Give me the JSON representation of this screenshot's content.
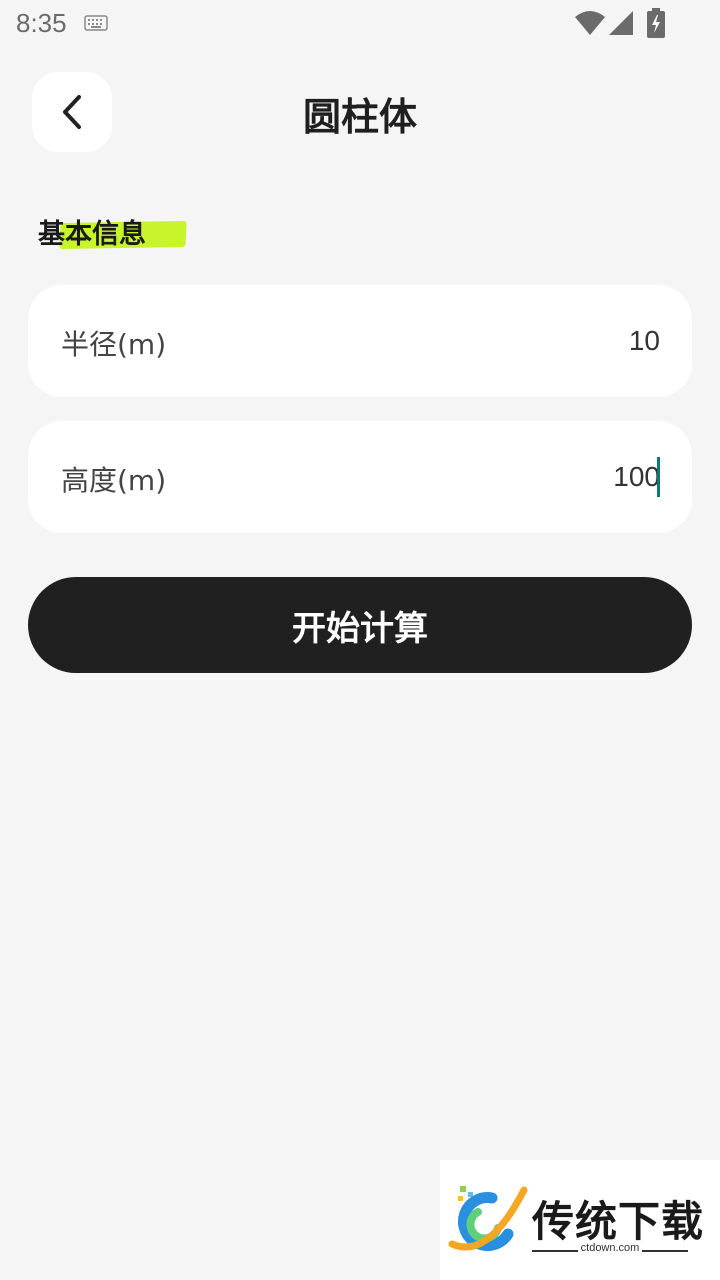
{
  "status_bar": {
    "time": "8:35"
  },
  "header": {
    "title": "圆柱体",
    "back_icon": "chevron-left-icon"
  },
  "section": {
    "title": "基本信息",
    "highlight_color": "#c7f42a"
  },
  "fields": [
    {
      "label": "半径(m)",
      "value": "10"
    },
    {
      "label": "高度(m)",
      "value": "100"
    }
  ],
  "actions": {
    "calculate_label": "开始计算"
  },
  "watermark": {
    "brand": "传统下载",
    "domain": "ctdown.com"
  },
  "colors": {
    "background": "#f5f5f5",
    "button": "#202020",
    "caret": "#0f7a6e"
  }
}
